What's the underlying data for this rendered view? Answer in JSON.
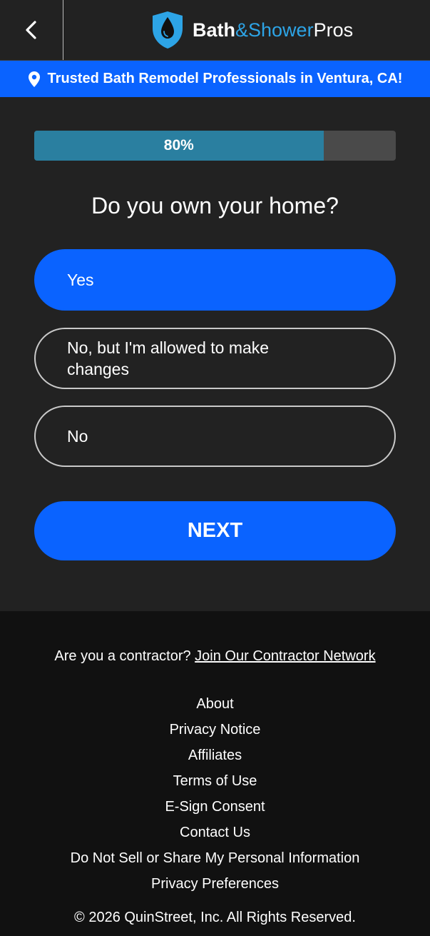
{
  "header": {
    "logo": {
      "part1": "Bath",
      "part2": "&Shower",
      "part3": "Pros"
    }
  },
  "banner": {
    "text": "Trusted Bath Remodel Professionals in Ventura, CA!"
  },
  "progress": {
    "value": 80,
    "label": "80%"
  },
  "question": {
    "text": "Do you own your home?"
  },
  "options": [
    {
      "label": "Yes",
      "selected": true
    },
    {
      "label": "No, but I'm allowed to make changes",
      "selected": false
    },
    {
      "label": "No",
      "selected": false
    }
  ],
  "next_button": {
    "label": "NEXT"
  },
  "footer": {
    "contractor_prompt": "Are you a contractor?",
    "contractor_link": "Join Our Contractor Network",
    "links": [
      "About",
      "Privacy Notice",
      "Affiliates",
      "Terms of Use",
      "E-Sign Consent",
      "Contact Us",
      "Do Not Sell or Share My Personal Information",
      "Privacy Preferences"
    ],
    "copyright": "© 2026 QuinStreet, Inc. All Rights Reserved."
  },
  "colors": {
    "accent": "#0a63ff",
    "logo_blue": "#2da4e6",
    "progress_fill": "#2a7fa0",
    "background": "#222222",
    "footer_background": "#111111"
  },
  "icons": {
    "back": "chevron-left-icon",
    "logo": "water-drop-shield-icon",
    "location": "map-pin-icon"
  }
}
